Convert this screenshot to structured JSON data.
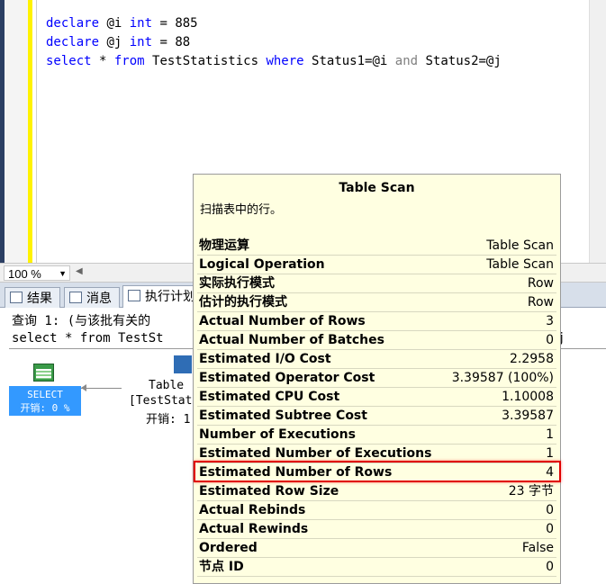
{
  "editor": {
    "lines": [
      {
        "k1": "declare",
        "var": " @i ",
        "k2": "int",
        "rest": " = 885"
      },
      {
        "k1": "declare",
        "var": " @j ",
        "k2": "int",
        "rest": " = 88"
      }
    ],
    "line3": {
      "k1": "select",
      "star": " * ",
      "k2": "from",
      "table": " TestStatistics ",
      "k3": "where",
      "c1": " Status1=@i ",
      "and": "and",
      "c2": " Status2=@j"
    }
  },
  "zoom": {
    "value": "100 %"
  },
  "tabs": [
    {
      "label": "结果"
    },
    {
      "label": "消息"
    },
    {
      "label": "执行计划"
    }
  ],
  "results": {
    "query_header": "查询 1: (与该批有关的",
    "query_sql": "select * from TestSt",
    "query_tail": "j",
    "select_node": {
      "label": "SELECT",
      "cost": "开销: 0 %"
    },
    "table_node": {
      "line1": "Table",
      "line2": "[TestStat",
      "line3": "开销: 1"
    }
  },
  "tooltip": {
    "title": "Table Scan",
    "description": "扫描表中的行。",
    "rows": [
      {
        "key": "物理运算",
        "value": "Table Scan"
      },
      {
        "key": "Logical Operation",
        "value": "Table Scan"
      },
      {
        "key": "实际执行模式",
        "value": "Row"
      },
      {
        "key": "估计的执行模式",
        "value": "Row"
      },
      {
        "key": "Actual Number of Rows",
        "value": "3"
      },
      {
        "key": "Actual Number of Batches",
        "value": "0"
      },
      {
        "key": "Estimated I/O Cost",
        "value": "2.2958"
      },
      {
        "key": "Estimated Operator Cost",
        "value": "3.39587 (100%)"
      },
      {
        "key": "Estimated CPU Cost",
        "value": "1.10008"
      },
      {
        "key": "Estimated Subtree Cost",
        "value": "3.39587"
      },
      {
        "key": "Number of Executions",
        "value": "1"
      },
      {
        "key": "Estimated Number of Executions",
        "value": "1"
      },
      {
        "key": "Estimated Number of Rows",
        "value": "4"
      },
      {
        "key": "Estimated Row Size",
        "value": "23 字节"
      },
      {
        "key": "Actual Rebinds",
        "value": "0"
      },
      {
        "key": "Actual Rewinds",
        "value": "0"
      },
      {
        "key": "Ordered",
        "value": "False"
      },
      {
        "key": "节点 ID",
        "value": "0"
      }
    ],
    "highlighted_key": "Estimated Number of Rows",
    "highlight_color": "#e00000"
  }
}
